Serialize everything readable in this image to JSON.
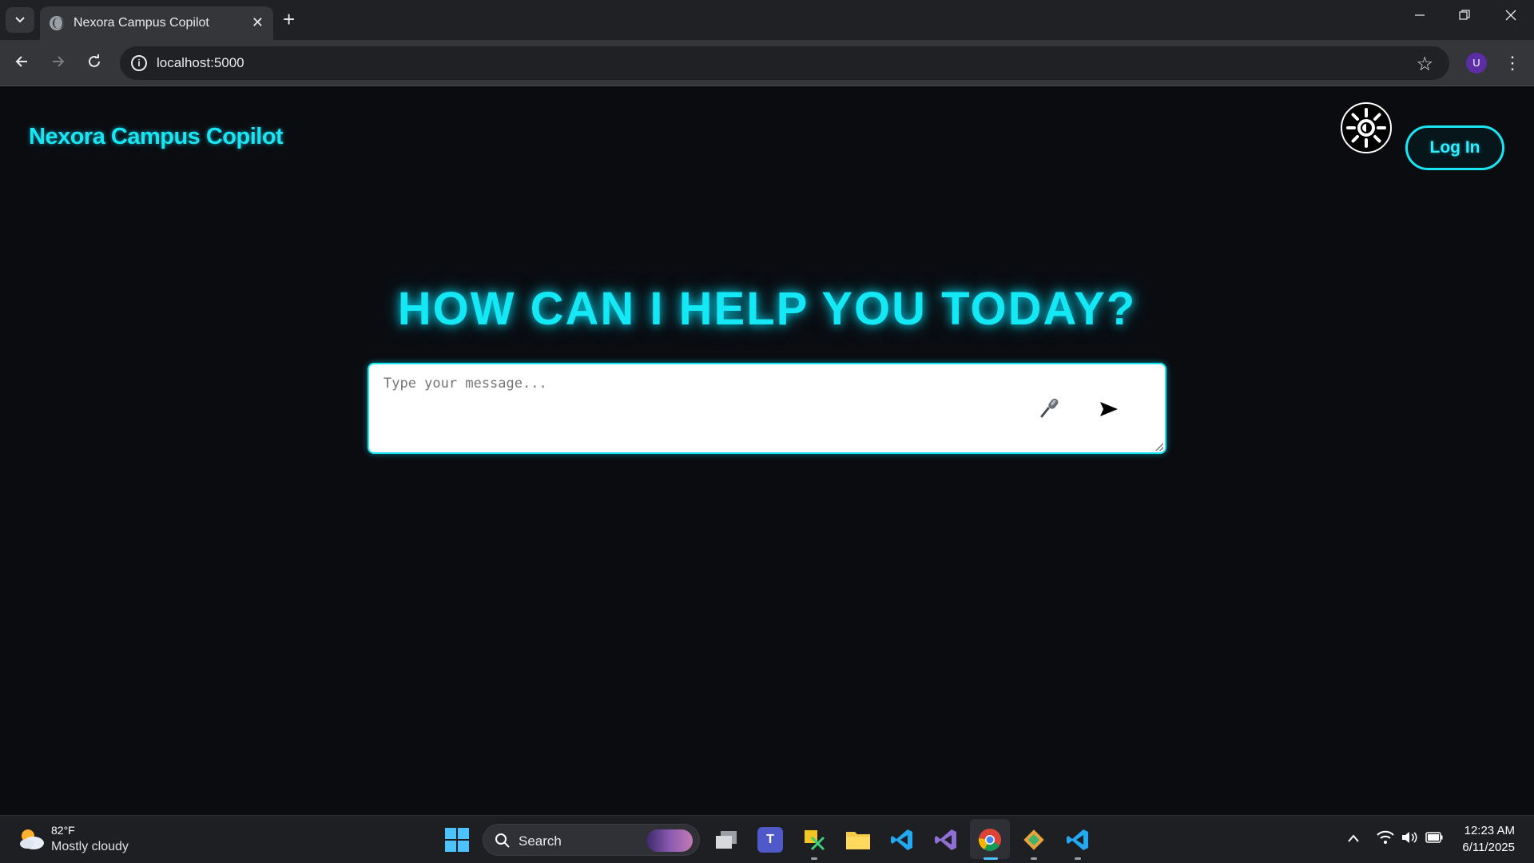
{
  "browser": {
    "tab_title": "Nexora Campus Copilot",
    "url": "localhost:5000",
    "profile_initial": "U",
    "new_tab_symbol": "+",
    "tab_close_symbol": "✕"
  },
  "page": {
    "brand": "Nexora Campus Copilot",
    "login_label": "Log In",
    "hero_heading": "HOW CAN I HELP YOU TODAY?",
    "chat": {
      "placeholder": "Type your message...",
      "value": ""
    },
    "colors": {
      "accent": "#19e6f2",
      "background": "#0a0c10",
      "input_background": "#ffffff"
    }
  },
  "taskbar": {
    "weather_temp": "82°F",
    "weather_desc": "Mostly cloudy",
    "search_label": "Search",
    "time": "12:23 AM",
    "date": "6/11/2025",
    "apps": [
      "task-view",
      "teams",
      "snipping-tool",
      "file-explorer",
      "vscode",
      "visual-studio",
      "chrome",
      "git",
      "vscode-2"
    ]
  }
}
